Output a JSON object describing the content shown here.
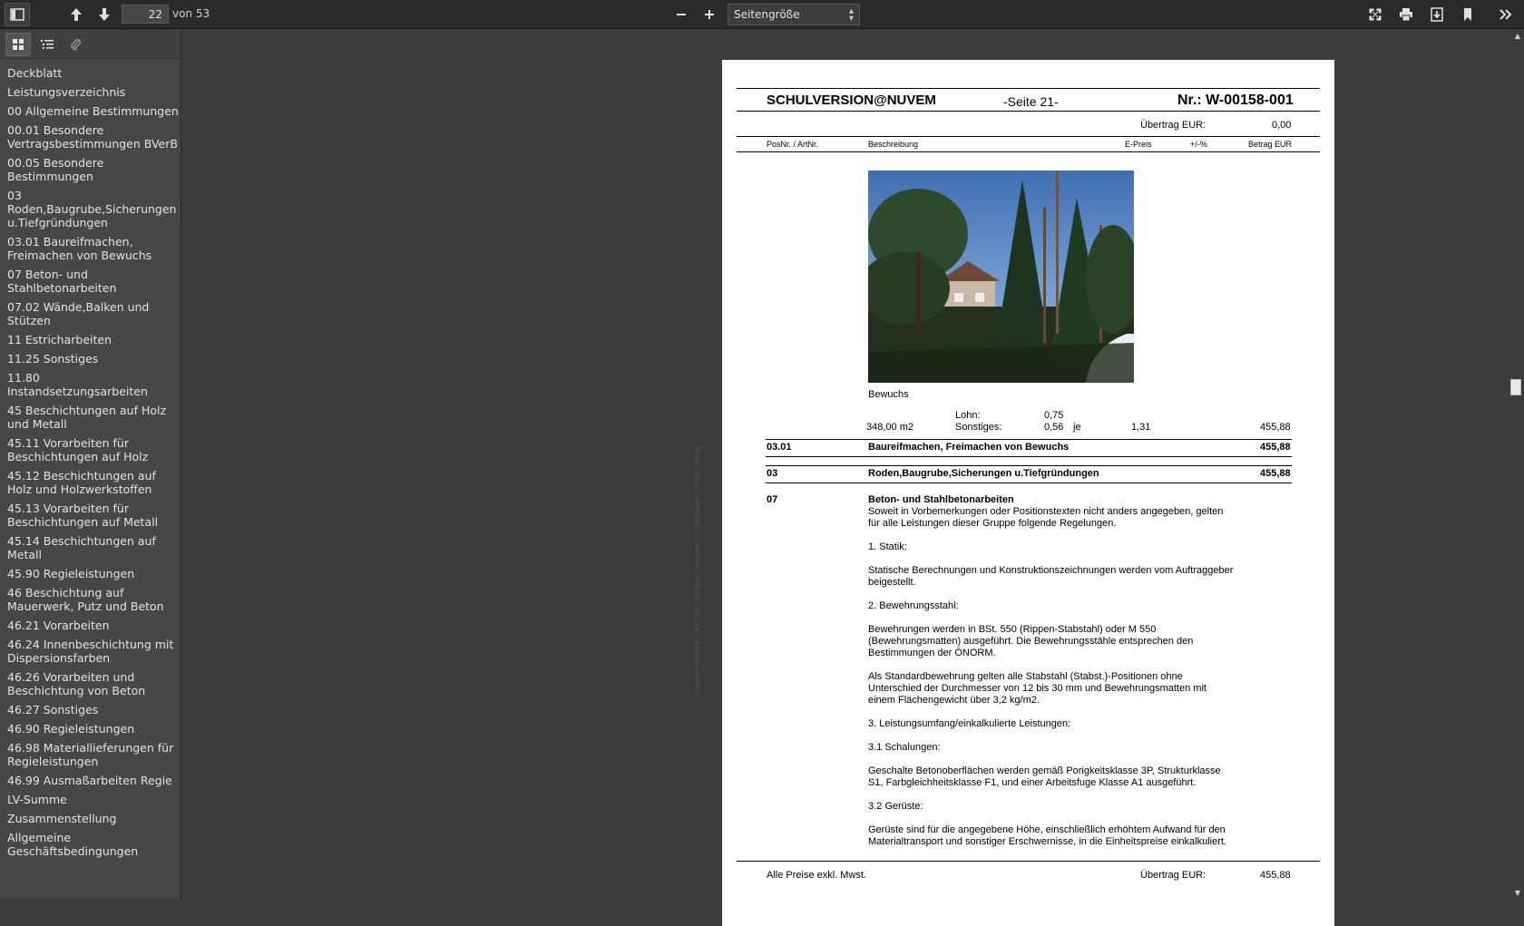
{
  "toolbar": {
    "page_number": "22",
    "page_total": "von 53",
    "zoom": "Seitengröße"
  },
  "outline": [
    "Deckblatt",
    "Leistungsverzeichnis",
    "00 Allgemeine Bestimmungen",
    "00.01 Besondere Vertragsbestimmungen BVerB",
    "00.05 Besondere Bestimmungen",
    "03 Roden,Baugrube,Sicherungen u.Tiefgründungen",
    "03.01 Baureifmachen, Freimachen von Bewuchs",
    "07 Beton- und Stahlbetonarbeiten",
    "07.02 Wände,Balken und Stützen",
    "11 Estricharbeiten",
    "11.25 Sonstiges",
    "11.80 Instandsetzungsarbeiten",
    "45 Beschichtungen auf Holz und Metall",
    "45.11 Vorarbeiten für Beschichtungen auf Holz",
    "45.12 Beschichtungen auf Holz und Holzwerkstoffen",
    "45.13 Vorarbeiten für Beschichtungen auf Metall",
    "45.14 Beschichtungen auf Metall",
    "45.90 Regieleistungen",
    "46 Beschichtung auf Mauerwerk, Putz und Beton",
    "46.21 Vorarbeiten",
    "46.24 Innenbeschichtung mit Dispersionsfarben",
    "46.26 Vorarbeiten und Beschichtung von Beton",
    "46.27 Sonstiges",
    "46.90 Regieleistungen",
    "46.98 Materiallieferungen für Regieleistungen",
    "46.99 Ausmaßarbeiten Regie",
    "LV-Summe",
    "Zusammenstellung",
    "Allgemeine Geschäftsbedingungen"
  ],
  "doc": {
    "company": "SCHULVERSION@NUVEM",
    "page_label": "-Seite 21-",
    "doc_number": "Nr.: W-00158-001",
    "carry_label": "Übertrag EUR:",
    "carry_value": "0,00",
    "col_pos": "PosNr. / ArtNr.",
    "col_desc": "Beschreibung",
    "col_eprice": "E-Preis",
    "col_pct": "+/-%",
    "col_amount": "Betrag EUR",
    "photo_caption": "Bewuchs",
    "lohn_label": "Lohn:",
    "lohn_value": "0,75",
    "qty": "348,00 m2",
    "sonst_label": "Sonstiges:",
    "sonst_value": "0,56",
    "je": "je",
    "unit_price": "1,31",
    "line_total": "455,88",
    "sum1_pos": "03.01",
    "sum1_desc": "Baureifmachen, Freimachen von Bewuchs",
    "sum1_value": "455,88",
    "sum2_pos": "03",
    "sum2_desc": "Roden,Baugrube,Sicherungen u.Tiefgründungen",
    "sum2_value": "455,88",
    "sec_pos": "07",
    "sec_title": "Beton- und Stahlbetonarbeiten",
    "p1a": "Soweit in Vorbemerkungen oder Positionstexten nicht anders angegeben, gelten",
    "p1b": "für alle Leistungen dieser Gruppe folgende Regelungen.",
    "h1": "1. Statik:",
    "p2a": "Statische Berechnungen und Konstruktionszeichnungen werden vom Auftraggeber",
    "p2b": "beigestellt.",
    "h2": "2. Bewehrungsstahl:",
    "p3a": "Bewehrungen werden in BSt. 550 (Rippen-Stabstahl) oder M 550",
    "p3b": "(Bewehrungsmatten) ausgeführt. Die Bewehrungsstähle entsprechen den",
    "p3c": "Bestimmungen der ÖNORM.",
    "p4a": "Als Standardbewehrung gelten alle Stabstahl (Stabst.)-Positionen ohne",
    "p4b": "Unterschied der Durchmesser von 12 bis 30 mm und Bewehrungsmatten mit",
    "p4c": "einem Flächengewicht über 3,2 kg/m2.",
    "h3": "3. Leistungsumfang/einkalkulierte Leistungen:",
    "h31": "3.1 Schalungen:",
    "p5a": "Geschalte Betonoberflächen werden gemäß Porigkeitsklasse 3P, Strukturklasse",
    "p5b": "S1, Farbgleichheitsklasse F1, und einer Arbeitsfuge Klasse A1 ausgeführt.",
    "h32": "3.2 Gerüste:",
    "p6a": "Gerüste sind für die angegebene Höhe, einschließlich erhöhtem Aufwand für den",
    "p6b": "Materialtransport und sonstiger Erschwernisse, in die Einheitspreise einkalkuliert.",
    "footer_note": "Alle Preise exkl. Mwst.",
    "footer_carry_label": "Übertrag EUR:",
    "footer_carry_value": "455,88",
    "side_credit": "Erstellt mit NUVEM - V05.0223-1216 (erp) - www.aseov.at - Kalkulation und Abrechnung"
  }
}
